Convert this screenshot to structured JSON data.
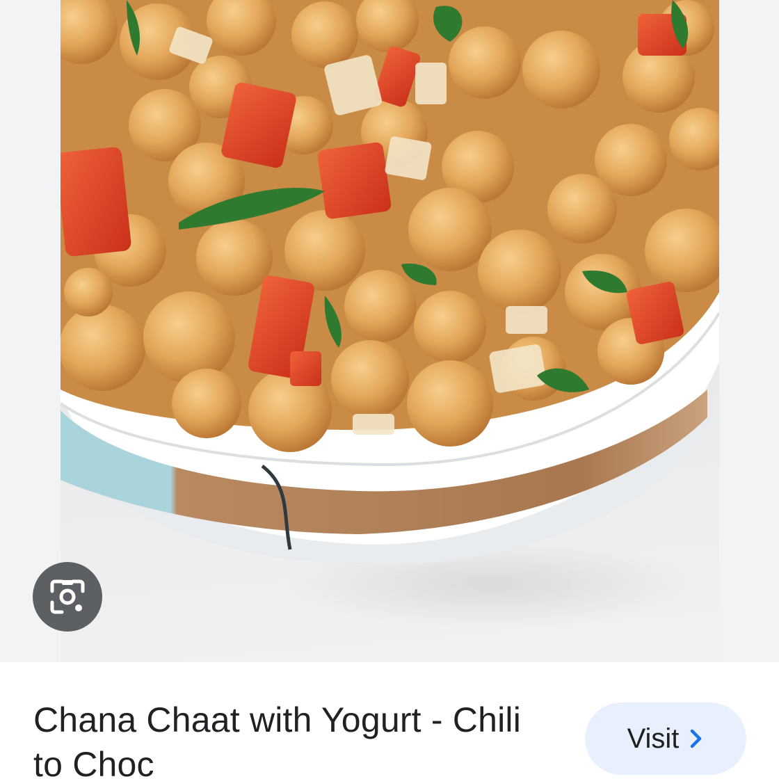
{
  "result": {
    "image": {
      "alt": "bowl of chana chaat",
      "lens_icon": "google-lens-icon"
    },
    "title": "Chana Chaat with Yogurt - Chili to Choc",
    "visit_button": {
      "label": "Visit",
      "icon": "chevron-right-icon"
    }
  },
  "colors": {
    "accent": "#1a73e8",
    "visit_bg": "#e8f0fe",
    "text": "#202124"
  }
}
